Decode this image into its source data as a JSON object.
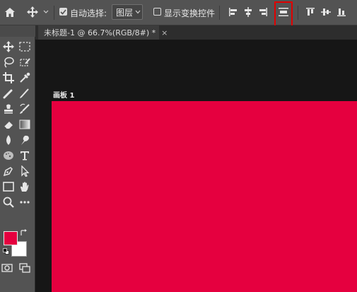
{
  "options_bar": {
    "home_icon": "home-icon",
    "move_tool_icon": "move-icon",
    "auto_select_label": "自动选择:",
    "auto_select_checked": true,
    "layer_select_value": "图层",
    "show_transform_label": "显示变换控件",
    "show_transform_checked": false,
    "highlight_color": "#e00000"
  },
  "document": {
    "tab_title": "未标题-1 @ 66.7%(RGB/8#) *",
    "close_glyph": "×",
    "artboard_label": "画板 1",
    "artboard_color": "#e5003f"
  },
  "tools": {
    "foreground_color": "#e5003f",
    "background_color": "#ffffff"
  }
}
